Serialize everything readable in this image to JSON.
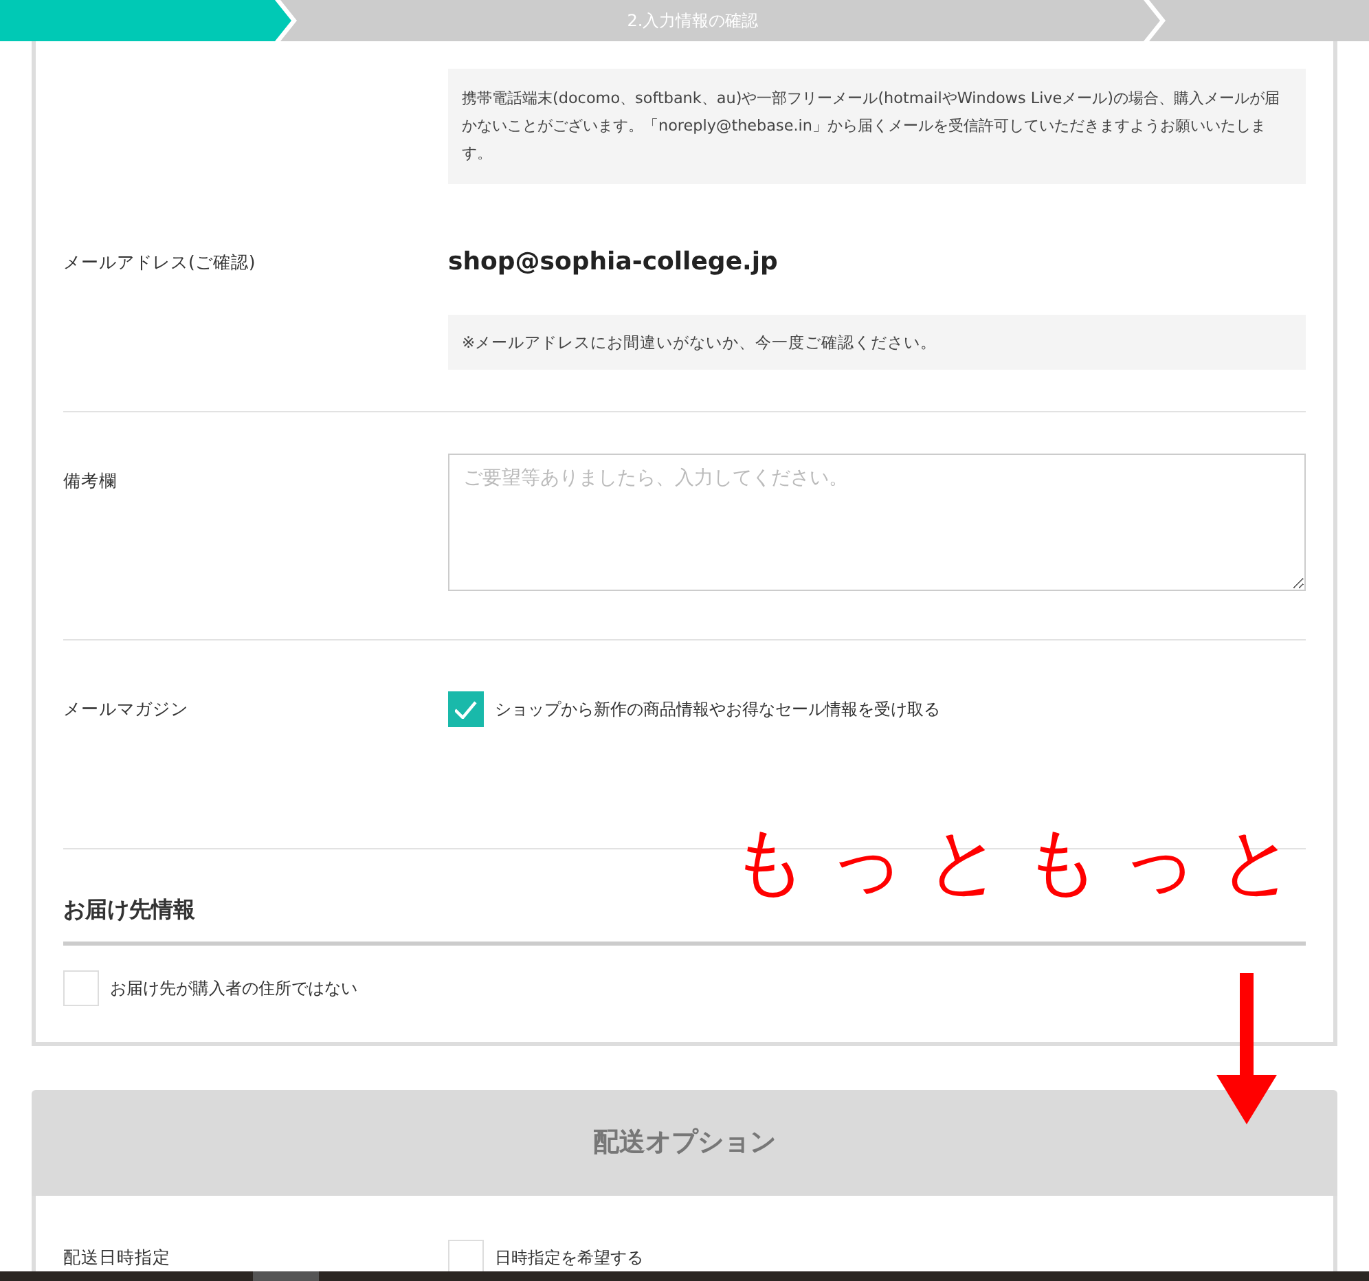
{
  "steps": [
    {
      "selected": true
    },
    {
      "label": "2.入力情報の確認",
      "selected": false
    },
    {
      "selected": false
    }
  ],
  "notice": "携帯電話端末(docomo、softbank、au)や一部フリーメール(hotmailやWindows Liveメール)の場合、購入メールが届かないことがございます。「noreply@thebase.in」から届くメールを受信許可していただきますようお願いいたします。",
  "email_confirm": {
    "label": "メールアドレス(ご確認)",
    "value": "shop@sophia-college.jp",
    "note": "※メールアドレスにお間違いがないか、今一度ご確認ください。"
  },
  "remarks": {
    "label": "備考欄",
    "placeholder": "ご要望等ありましたら、入力してください。"
  },
  "newsletter": {
    "label": "メールマガジン",
    "option": "ショップから新作の商品情報やお得なセール情報を受け取る",
    "checked": true
  },
  "delivery_info": {
    "heading": "お届け先情報",
    "option": "お届け先が購入者の住所ではない",
    "checked": false
  },
  "shipping_options": {
    "heading": "配送オプション",
    "rows": [
      {
        "label": "配送日時指定",
        "option": "日時指定を希望する",
        "checked": false
      }
    ]
  },
  "annotation": {
    "text": "もっともっと"
  }
}
